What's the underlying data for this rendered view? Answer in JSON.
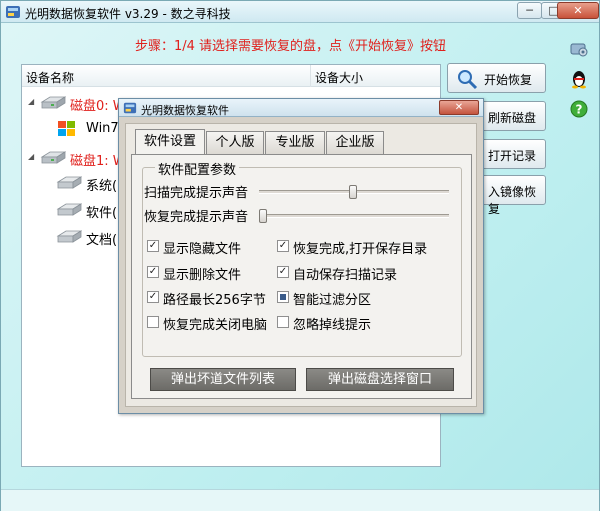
{
  "window": {
    "title": "光明数据恢复软件 v3.29 - 数之寻科技",
    "controls": {
      "minimize": "─",
      "maximize": "□",
      "close": "✕"
    }
  },
  "step_text": "步骤：1/4 请选择需要恢复的盘，点《开始恢复》按钮",
  "disk_list": {
    "headers": {
      "name": "设备名称",
      "size": "设备大小"
    },
    "rows": [
      {
        "label": "磁盘0: W",
        "level": 0,
        "color": "#e0201c",
        "icon": "hard-disk-icon"
      },
      {
        "label": "Win7",
        "level": 1,
        "color": "#000000",
        "icon": "windows-logo-icon"
      },
      {
        "label": "磁盘1: W",
        "level": 0,
        "color": "#e0201c",
        "icon": "hard-disk-icon"
      },
      {
        "label": "系统(",
        "level": 1,
        "color": "#000000",
        "icon": "partition-icon"
      },
      {
        "label": "软件(",
        "level": 1,
        "color": "#000000",
        "icon": "partition-icon"
      },
      {
        "label": "文档(",
        "level": 1,
        "color": "#000000",
        "icon": "partition-icon"
      }
    ]
  },
  "right_buttons": {
    "start": "开始恢复",
    "refresh": "刷新磁盘",
    "open_record": "打开记录",
    "image_restore": "入镜像恢复"
  },
  "dialog": {
    "title": "光明数据恢复软件",
    "close": "✕",
    "tabs": [
      "软件设置",
      "个人版",
      "专业版",
      "企业版"
    ],
    "active_tab": 0,
    "group_title": "软件配置参数",
    "sliders": [
      {
        "label": "扫描完成提示声音",
        "level": 0.5
      },
      {
        "label": "恢复完成提示声音",
        "level": 0.0
      }
    ],
    "checkboxes": [
      {
        "label": "显示隐藏文件",
        "state": "checked"
      },
      {
        "label": "恢复完成,打开保存目录",
        "state": "checked"
      },
      {
        "label": "显示删除文件",
        "state": "checked"
      },
      {
        "label": "自动保存扫描记录",
        "state": "checked"
      },
      {
        "label": "路径最长256字节",
        "state": "checked"
      },
      {
        "label": "智能过滤分区",
        "state": "indeterminate"
      },
      {
        "label": "恢复完成关闭电脑",
        "state": "unchecked"
      },
      {
        "label": "忽略掉线提示",
        "state": "unchecked"
      }
    ],
    "buttons": {
      "bad_sector_list": "弹出坏道文件列表",
      "disk_select_window": "弹出磁盘选择窗口"
    }
  },
  "colors": {
    "accent_red": "#e0201c",
    "window_bg": "#bfeff0",
    "dialog_bg": "#ece9e3"
  },
  "side_icons": [
    "settings-gear-icon",
    "qq-penguin-icon",
    "help-question-icon"
  ]
}
